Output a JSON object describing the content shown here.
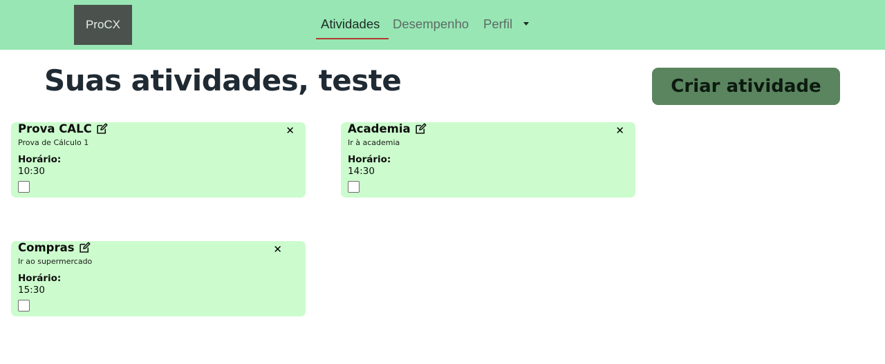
{
  "navbar": {
    "brand": "ProCX",
    "links": [
      {
        "label": "Atividades",
        "active": true
      },
      {
        "label": "Desempenho",
        "active": false
      },
      {
        "label": "Perfil",
        "active": false
      }
    ]
  },
  "main": {
    "title": "Suas atividades, teste",
    "create_button": "Criar atividade"
  },
  "activities": [
    {
      "title": "Prova CALC",
      "description": "Prova de Cálculo 1",
      "time_label": "Horário:",
      "time": "10:30",
      "done": false
    },
    {
      "title": "Academia",
      "description": "Ir à academia",
      "time_label": "Horário:",
      "time": "14:30",
      "done": false
    },
    {
      "title": "Compras",
      "description": "Ir ao supermercado",
      "time_label": "Horário:",
      "time": "15:30",
      "done": false
    }
  ],
  "icons": {
    "edit": "edit-icon",
    "close": "close-icon",
    "dropdown": "chevron-down-icon"
  },
  "colors": {
    "navbar_bg": "#97e6b4",
    "card_bg": "#ccfccd",
    "button_bg": "#5a855f",
    "active_underline": "#b23a2d"
  }
}
